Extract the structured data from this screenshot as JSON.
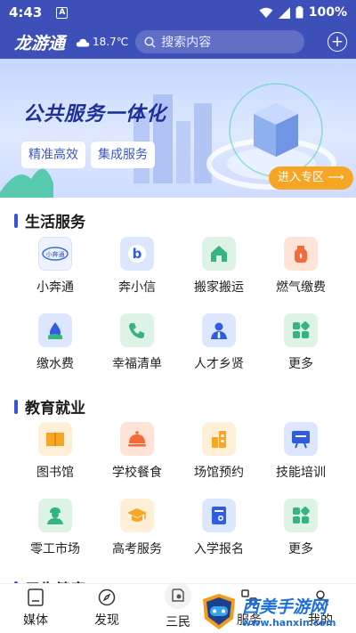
{
  "status": {
    "time": "4:43",
    "notif_icon": "A",
    "battery": "100%"
  },
  "header": {
    "logo": "龙游通",
    "temperature": "18.7℃",
    "search_placeholder": "搜索内容"
  },
  "banner": {
    "title": "公共服务一体化",
    "tags": [
      "精准高效",
      "集成服务"
    ],
    "enter": "进入专区 ⟶"
  },
  "sections": [
    {
      "title": "生活服务",
      "items": [
        {
          "label": "小奔通",
          "icon": "xiaoben-logo-icon",
          "color": "#dfe8ff"
        },
        {
          "label": "奔小信",
          "icon": "letter-b-icon",
          "color": "#dce6ff"
        },
        {
          "label": "搬家搬运",
          "icon": "house-icon",
          "color": "#dcf3e6"
        },
        {
          "label": "燃气缴费",
          "icon": "gas-tank-icon",
          "color": "#ffe3d6"
        },
        {
          "label": "缴水费",
          "icon": "water-drop-icon",
          "color": "#dce6ff"
        },
        {
          "label": "幸福清单",
          "icon": "phone-icon",
          "color": "#dcf3e6"
        },
        {
          "label": "人才乡贤",
          "icon": "person-icon",
          "color": "#dce6ff"
        },
        {
          "label": "更多",
          "icon": "grid-more-icon",
          "color": "#dcf3e6"
        }
      ]
    },
    {
      "title": "教育就业",
      "items": [
        {
          "label": "图书馆",
          "icon": "book-icon",
          "color": "#ffefd6"
        },
        {
          "label": "学校餐食",
          "icon": "cloche-icon",
          "color": "#ffe3d6"
        },
        {
          "label": "场馆预约",
          "icon": "building-icon",
          "color": "#ffefd6"
        },
        {
          "label": "技能培训",
          "icon": "board-icon",
          "color": "#dce6ff"
        },
        {
          "label": "零工市场",
          "icon": "worker-icon",
          "color": "#dcf3e6"
        },
        {
          "label": "高考服务",
          "icon": "graduation-cap-icon",
          "color": "#ffefd6"
        },
        {
          "label": "入学报名",
          "icon": "enroll-form-icon",
          "color": "#dce6ff"
        },
        {
          "label": "更多",
          "icon": "grid-more-icon",
          "color": "#dcf3e6"
        }
      ]
    },
    {
      "title": "卫生健康"
    }
  ],
  "nav": [
    {
      "label": "媒体",
      "icon": "media-icon"
    },
    {
      "label": "发现",
      "icon": "compass-icon"
    },
    {
      "label": "三民",
      "icon": "sanmin-icon"
    },
    {
      "label": "服务",
      "icon": "service-icon"
    },
    {
      "label": "我的",
      "icon": "profile-icon"
    }
  ],
  "watermark": {
    "text": "西美手游网",
    "url": "www.hanxin.com"
  },
  "colors": {
    "primary": "#3d4fb8",
    "accent": "#f6a624",
    "section_bar": "#3553d4"
  }
}
